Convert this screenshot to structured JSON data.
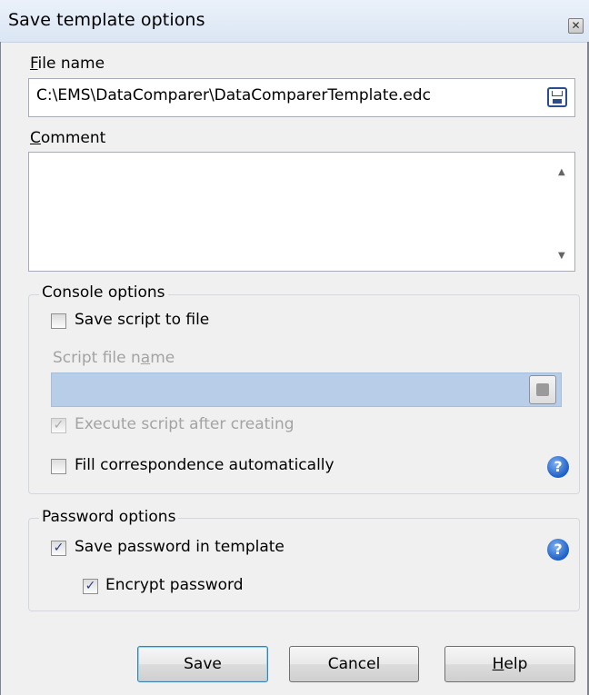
{
  "window": {
    "title": "Save template options",
    "close_glyph": "✕"
  },
  "file_name": {
    "label_hot": "F",
    "label_rest": "ile name",
    "value": "C:\\EMS\\DataComparer\\DataComparerTemplate.edc",
    "browse_icon": "save-icon"
  },
  "comment": {
    "label_hot": "C",
    "label_rest": "omment",
    "value": "",
    "scroll_up": "▲",
    "scroll_down": "▼"
  },
  "console_options": {
    "title": "Console options",
    "save_script": {
      "label": "Save script to file",
      "checked": false
    },
    "script_file_name": {
      "label_pre": "Script file n",
      "label_hot": "a",
      "label_post": "me",
      "value": ""
    },
    "execute_script": {
      "label": "Execute script after creating",
      "checked": true,
      "check_glyph": "✓"
    },
    "fill_correspondence": {
      "label": "Fill correspondence automatically",
      "checked": false
    },
    "help_glyph": "?"
  },
  "password_options": {
    "title": "Password options",
    "save_password": {
      "label": "Save password in template",
      "checked": true,
      "check_glyph": "✓"
    },
    "encrypt_password": {
      "label": "Encrypt password",
      "checked": true,
      "check_glyph": "✓"
    },
    "help_glyph": "?"
  },
  "buttons": {
    "save": "Save",
    "cancel": "Cancel",
    "help_hot": "H",
    "help_rest": "elp"
  }
}
